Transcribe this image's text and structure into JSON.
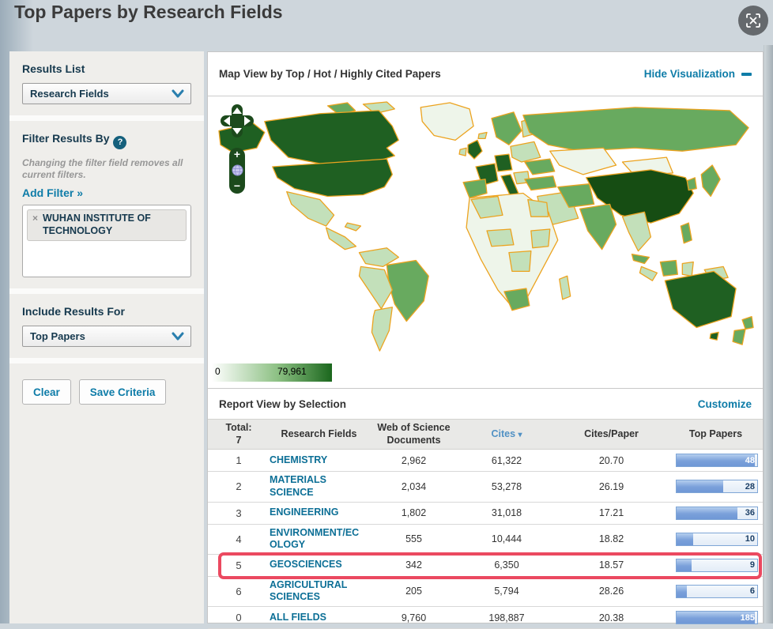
{
  "page": {
    "title": "Top Papers by Research Fields"
  },
  "icons": {
    "tag_remove": "×",
    "help": "?",
    "zoom_in": "+",
    "zoom_out": "−",
    "sort_arrow": "▾"
  },
  "sidebar": {
    "results_list": {
      "heading": "Results List",
      "selected": "Research Fields"
    },
    "filter": {
      "heading": "Filter Results By",
      "note": "Changing the filter field removes all current filters.",
      "add_filter_label": "Add Filter »",
      "tags": [
        {
          "label": "WUHAN INSTITUTE OF TECHNOLOGY"
        }
      ]
    },
    "include_results": {
      "heading": "Include Results For",
      "selected": "Top Papers"
    },
    "buttons": {
      "clear": "Clear",
      "save": "Save Criteria"
    }
  },
  "map_section": {
    "title": "Map View by Top / Hot / Highly Cited Papers",
    "hide_label": "Hide Visualization",
    "legend": {
      "min": "0",
      "max": "79,961"
    },
    "palette": {
      "ocean": "#ffffff",
      "border": "#eca31f",
      "lightest": "#eef5ea",
      "light": "#c3e0ba",
      "medium": "#68aa5f",
      "dark": "#1f6022",
      "darkest": "#164d13"
    },
    "legend_gradient": [
      "#ffffff",
      "#8cc083",
      "#1b671d"
    ]
  },
  "report": {
    "title": "Report View by Selection",
    "customize_label": "Customize",
    "table": {
      "headers": {
        "total_line1": "Total:",
        "total_line2": "7",
        "field": "Research Fields",
        "docs": "Web of Science Documents",
        "cites": "Cites",
        "cites_per_paper": "Cites/Paper",
        "top_papers": "Top Papers"
      },
      "rows": [
        {
          "rank": "1",
          "field": "CHEMISTRY",
          "docs": "2,962",
          "cites": "61,322",
          "cites_per_paper": "20.70",
          "top_papers": "48",
          "bar_pct": 97,
          "highlighted": false
        },
        {
          "rank": "2",
          "field": "MATERIALS SCIENCE",
          "docs": "2,034",
          "cites": "53,278",
          "cites_per_paper": "26.19",
          "top_papers": "28",
          "bar_pct": 58,
          "highlighted": false
        },
        {
          "rank": "3",
          "field": "ENGINEERING",
          "docs": "1,802",
          "cites": "31,018",
          "cites_per_paper": "17.21",
          "top_papers": "36",
          "bar_pct": 75,
          "highlighted": false
        },
        {
          "rank": "4",
          "field": "ENVIRONMENT/ECOLOGY",
          "docs": "555",
          "cites": "10,444",
          "cites_per_paper": "18.82",
          "top_papers": "10",
          "bar_pct": 21,
          "highlighted": false
        },
        {
          "rank": "5",
          "field": "GEOSCIENCES",
          "docs": "342",
          "cites": "6,350",
          "cites_per_paper": "18.57",
          "top_papers": "9",
          "bar_pct": 19,
          "highlighted": true
        },
        {
          "rank": "6",
          "field": "AGRICULTURAL SCIENCES",
          "docs": "205",
          "cites": "5,794",
          "cites_per_paper": "28.26",
          "top_papers": "6",
          "bar_pct": 13,
          "highlighted": false
        },
        {
          "rank": "0",
          "field": "ALL FIELDS",
          "docs": "9,760",
          "cites": "198,887",
          "cites_per_paper": "20.38",
          "top_papers": "185",
          "bar_pct": 97,
          "highlighted": false
        }
      ]
    }
  }
}
